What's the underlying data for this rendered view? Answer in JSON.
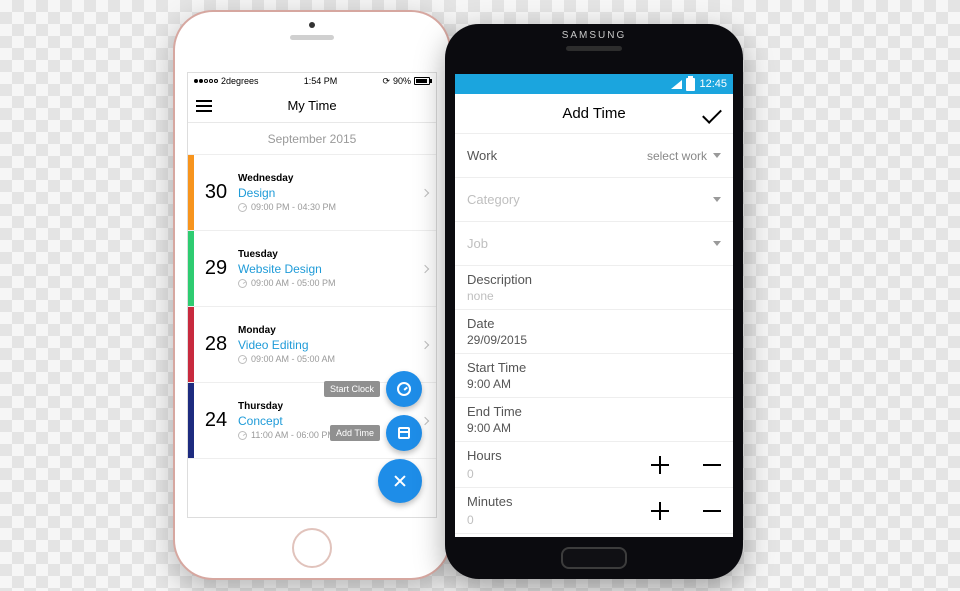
{
  "iphone": {
    "status": {
      "carrier": "2degrees",
      "time": "1:54 PM",
      "battery_pct": "90%"
    },
    "title": "My Time",
    "month": "September 2015",
    "entries": [
      {
        "color": "#f7941d",
        "day": "30",
        "weekday": "Wednesday",
        "task": "Design",
        "time": "09:00 PM - 04:30 PM"
      },
      {
        "color": "#2ecc71",
        "day": "29",
        "weekday": "Tuesday",
        "task": "Website Design",
        "time": "09:00 AM - 05:00 PM"
      },
      {
        "color": "#c82a3e",
        "day": "28",
        "weekday": "Monday",
        "task": "Video Editing",
        "time": "09:00 AM - 05:00 AM"
      },
      {
        "color": "#1d2b7f",
        "day": "24",
        "weekday": "Thursday",
        "task": "Concept",
        "time": "11:00 AM - 06:00 PM"
      }
    ],
    "fab": {
      "start_clock": "Start Clock",
      "add_time": "Add Time"
    }
  },
  "samsung": {
    "brand": "SAMSUNG",
    "status": {
      "time": "12:45"
    },
    "title": "Add Time",
    "form": {
      "work": {
        "label": "Work",
        "select": "select work"
      },
      "category": {
        "label": "Category"
      },
      "job": {
        "label": "Job"
      },
      "description": {
        "label": "Description",
        "value": "none"
      },
      "date": {
        "label": "Date",
        "value": "29/09/2015"
      },
      "start": {
        "label": "Start Time",
        "value": "9:00 AM"
      },
      "end": {
        "label": "End Time",
        "value": "9:00 AM"
      },
      "hours": {
        "label": "Hours",
        "value": "0"
      },
      "minutes": {
        "label": "Minutes",
        "value": "0"
      }
    }
  }
}
